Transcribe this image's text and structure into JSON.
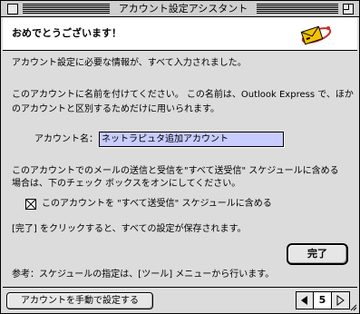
{
  "window": {
    "title": "アカウント設定アシスタント"
  },
  "header": {
    "title": "おめでとうございます！",
    "icon": "mail-envelope-icon"
  },
  "body": {
    "line1": "アカウント設定に必要な情報が、すべて入力されました。",
    "line2": "このアカウントに名前を付けてください。 この名前は、Outlook Express で、ほか",
    "line3": "のアカウントと区別するためだけに用いられます。",
    "account_name_label": "アカウント名：",
    "account_name_value": "ネットラピュタ追加アカウント",
    "line4": "このアカウントでのメールの送信と受信を\"すべて送受信\" スケジュールに含める",
    "line5": "場合は、下のチェック ボックスをオンにしてください。",
    "checkbox_label": "このアカウントを \"すべて送受信\" スケジュールに含める",
    "checkbox_checked": true,
    "line6": "[完了] をクリックすると、すべての設定が保存されます。",
    "done_button": "完了",
    "note": "参考：スケジュールの指定は、[ツール] メニューから行います。"
  },
  "footer": {
    "manual_button": "アカウントを手動で設定する",
    "page_number": "5"
  }
}
